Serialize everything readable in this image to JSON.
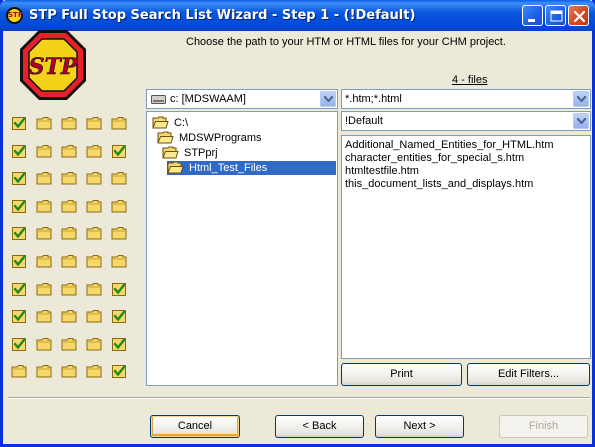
{
  "window": {
    "title": "STP Full Stop Search List Wizard - Step 1 - (!Default)",
    "icon_text": "STP"
  },
  "logo": {
    "text": "STP"
  },
  "instruction": "Choose the path to your HTM or HTML files for your CHM project.",
  "drive": {
    "value": "c: [MDSWAAM]"
  },
  "filter": {
    "value": "*.htm;*.html"
  },
  "profile": {
    "value": "!Default"
  },
  "files_count": "4 - files",
  "folders": [
    {
      "label": "C:\\",
      "depth": 0,
      "selected": false
    },
    {
      "label": "MDSWPrograms",
      "depth": 1,
      "selected": false
    },
    {
      "label": "STPprj",
      "depth": 2,
      "selected": false
    },
    {
      "label": "Html_Test_Files",
      "depth": 3,
      "selected": true
    }
  ],
  "files": [
    "Additional_Named_Entities_for_HTML.htm",
    "character_entities_for_special_s.htm",
    "htmltestfile.htm",
    "this_document_lists_and_displays.htm"
  ],
  "status_grid": [
    [
      "checked",
      "folder",
      "folder",
      "folder",
      "folder"
    ],
    [
      "checked",
      "folder",
      "folder",
      "folder",
      "checked"
    ],
    [
      "checked",
      "folder",
      "folder",
      "folder",
      "folder"
    ],
    [
      "checked",
      "folder",
      "folder",
      "folder",
      "folder"
    ],
    [
      "checked",
      "folder",
      "folder",
      "folder",
      "folder"
    ],
    [
      "checked",
      "folder",
      "folder",
      "folder",
      "folder"
    ],
    [
      "checked",
      "folder",
      "folder",
      "folder",
      "checked"
    ],
    [
      "checked",
      "folder",
      "folder",
      "folder",
      "checked"
    ],
    [
      "checked",
      "folder",
      "folder",
      "folder",
      "checked"
    ],
    [
      "folder",
      "folder",
      "folder",
      "folder",
      "checked"
    ]
  ],
  "buttons": {
    "print": "Print",
    "edit_filters": "Edit Filters...",
    "cancel": "Cancel",
    "back": "< Back",
    "next": "Next >",
    "finish": "Finish"
  },
  "colors": {
    "titlebar": "#0058E6",
    "face": "#ECE9D8",
    "selection": "#316AC5",
    "logo_octagon": "#E8202A",
    "logo_fill": "#F5D21A"
  }
}
